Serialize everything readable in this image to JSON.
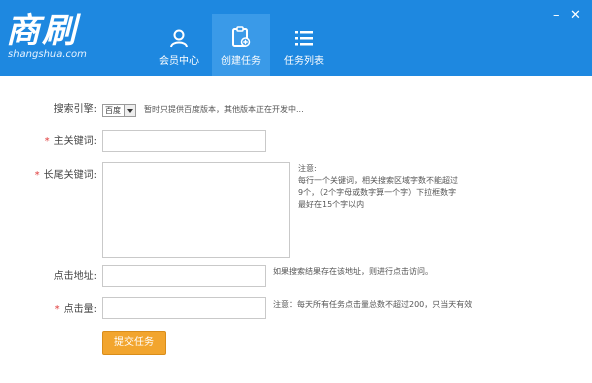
{
  "header": {
    "logo_main": "商刷",
    "logo_sub": "shangshua.com",
    "nav": [
      {
        "label": "会员中心",
        "icon": "user-icon"
      },
      {
        "label": "创建任务",
        "icon": "clipboard-add-icon"
      },
      {
        "label": "任务列表",
        "icon": "list-icon"
      }
    ],
    "active_index": 1,
    "minimize": "–",
    "close": "✕"
  },
  "form": {
    "engine_label": "搜索引擎:",
    "engine_value": "百度",
    "engine_note": "暂时只提供百度版本，其他版本正在开发中...",
    "main_keyword_label": "主关键词:",
    "main_keyword_value": "",
    "long_keyword_label": "长尾关键词:",
    "long_keyword_value": "",
    "long_keyword_note_title": "注意:",
    "long_keyword_note_lines": [
      "每行一个关键词，相关搜索区域字数不能超过",
      "9个，（2个字母或数字算一个字）下拉框数字",
      "最好在15个字以内"
    ],
    "click_url_label": "点击地址:",
    "click_url_value": "",
    "click_url_note": "如果搜索结果存在该地址，则进行点击访问。",
    "click_count_label": "点击量:",
    "click_count_value": "",
    "click_count_note": "注意：每天所有任务点击量总数不超过200，只当天有效",
    "required_mark": "*",
    "submit_label": "提交任务"
  },
  "colors": {
    "header_bg": "#1e88e0",
    "nav_active_bg": "#3a9ae8",
    "submit_bg": "#f2a52e",
    "required": "#e03a3a"
  }
}
